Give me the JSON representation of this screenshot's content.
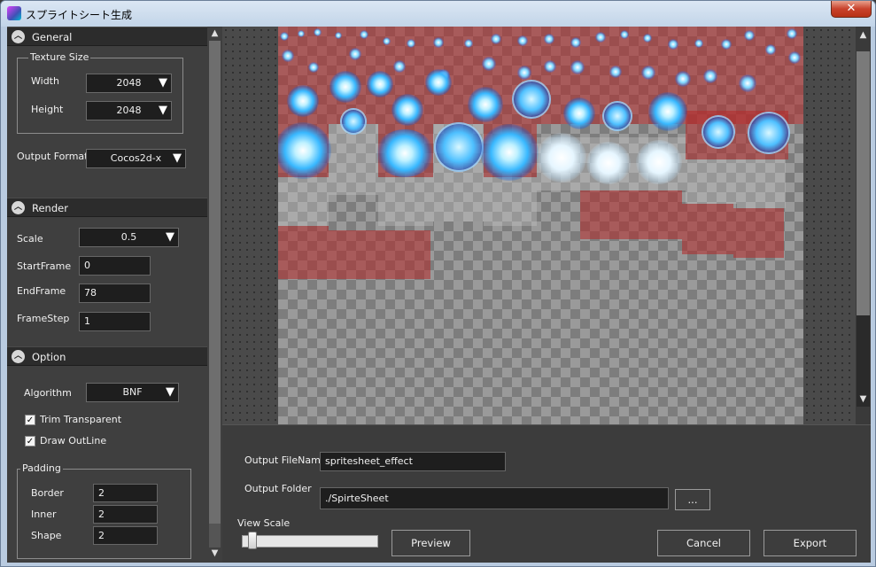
{
  "window": {
    "title": "スプライトシート生成",
    "close_glyph": "✕"
  },
  "general": {
    "header": "General",
    "texture_size": {
      "title": "Texture Size",
      "width_label": "Width",
      "width_value": "2048",
      "height_label": "Height",
      "height_value": "2048"
    },
    "output_format_label": "Output Format",
    "output_format_value": "Cocos2d-x"
  },
  "render": {
    "header": "Render",
    "scale_label": "Scale",
    "scale_value": "0.5",
    "start_frame_label": "StartFrame",
    "start_frame_value": "0",
    "end_frame_label": "EndFrame",
    "end_frame_value": "78",
    "frame_step_label": "FrameStep",
    "frame_step_value": "1"
  },
  "option": {
    "header": "Option",
    "algorithm_label": "Algorithm",
    "algorithm_value": "BNF",
    "trim_transparent_label": "Trim Transparent",
    "trim_transparent_checked": true,
    "draw_outline_label": "Draw OutLine",
    "draw_outline_checked": true,
    "padding": {
      "title": "Padding",
      "border_label": "Border",
      "border_value": "2",
      "inner_label": "Inner",
      "inner_value": "2",
      "shape_label": "Shape",
      "shape_value": "2"
    }
  },
  "output": {
    "filename_label": "Output FileName",
    "filename_value": "spritesheet_effect",
    "folder_label": "Output Folder",
    "folder_value": "./SpirteSheet",
    "browse_label": "...",
    "view_scale_label": "View Scale",
    "view_scale_level": 0.05,
    "preview_label": "Preview",
    "cancel_label": "Cancel",
    "export_label": "Export"
  },
  "icons": {
    "collapse": "chevron-up-icon",
    "dropdown": "triangle-down-icon",
    "check": "checkmark-icon",
    "scroll_up": "scroll-up-arrow-icon",
    "scroll_down": "scroll-down-arrow-icon",
    "app": "app-icon"
  },
  "colors": {
    "panel_bg": "#3f3f3f",
    "section_header": "#2c2c2c",
    "field_bg": "#1e1e1e",
    "glow_blue": "#38b8ff",
    "tile_red": "#b42828",
    "titlebar": "#c2d4e8",
    "close_red": "#c8422c"
  }
}
